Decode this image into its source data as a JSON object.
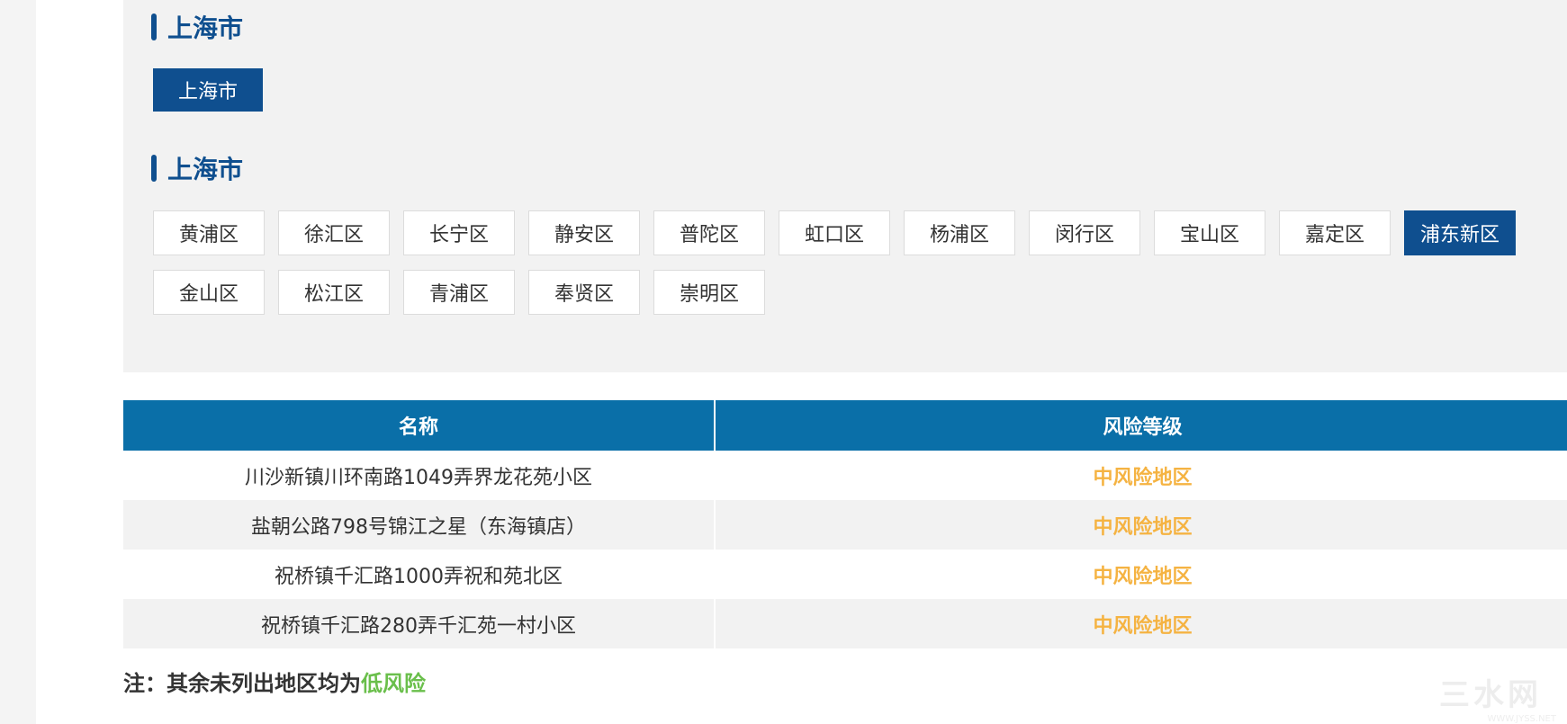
{
  "province_section": {
    "title": "上海市",
    "selected_city": "上海市"
  },
  "city_section": {
    "title": "上海市",
    "districts": [
      "黄浦区",
      "徐汇区",
      "长宁区",
      "静安区",
      "普陀区",
      "虹口区",
      "杨浦区",
      "闵行区",
      "宝山区",
      "嘉定区",
      "浦东新区",
      "金山区",
      "松江区",
      "青浦区",
      "奉贤区",
      "崇明区"
    ],
    "active_district": "浦东新区"
  },
  "table": {
    "headers": {
      "name": "名称",
      "risk_level": "风险等级"
    },
    "rows": [
      {
        "name": "川沙新镇川环南路1049弄界龙花苑小区",
        "level": "中风险地区"
      },
      {
        "name": "盐朝公路798号锦江之星（东海镇店）",
        "level": "中风险地区"
      },
      {
        "name": "祝桥镇千汇路1000弄祝和苑北区",
        "level": "中风险地区"
      },
      {
        "name": "祝桥镇千汇路280弄千汇苑一村小区",
        "level": "中风险地区"
      }
    ]
  },
  "note": {
    "prefix": "注：其余未列出地区均为",
    "highlight": "低风险"
  },
  "watermark": {
    "main": "三水网",
    "sub": "WWW.JYSS.NET"
  },
  "colors": {
    "primary": "#0f4f8f",
    "table_header": "#0a6fa8",
    "medium_risk": "#f5b342",
    "low_risk": "#6abf4b"
  }
}
